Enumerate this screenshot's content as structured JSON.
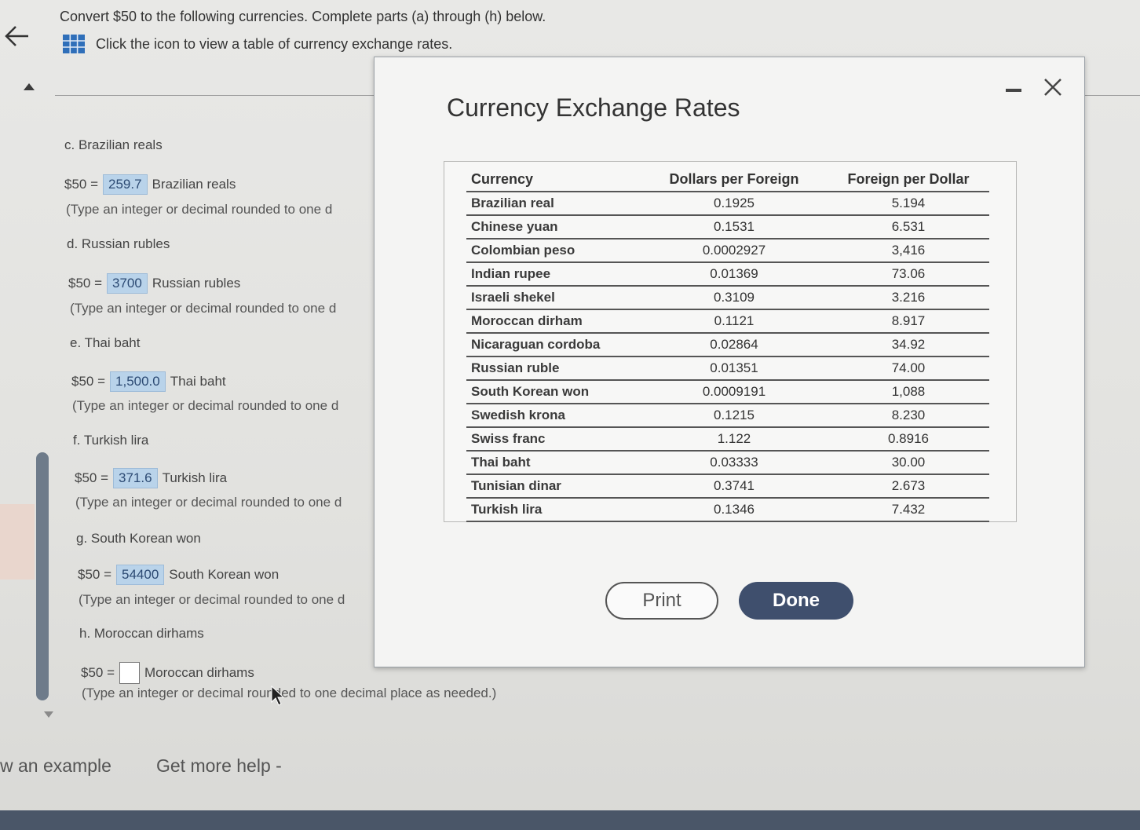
{
  "question": {
    "title": "Convert $50 to the following currencies. Complete parts (a) through (h) below.",
    "hint": "Click the icon to view a table of currency exchange rates."
  },
  "parts": [
    {
      "label": "c. Brazilian reals",
      "prefix": "$50 =",
      "value": "259.7",
      "unit": "Brazilian reals",
      "hint": "(Type an integer or decimal rounded to one d"
    },
    {
      "label": "d. Russian rubles",
      "prefix": "$50 =",
      "value": "3700",
      "unit": "Russian rubles",
      "hint": "(Type an integer or decimal rounded to one d"
    },
    {
      "label": "e. Thai baht",
      "prefix": "$50 =",
      "value": "1,500.0",
      "unit": "Thai baht",
      "hint": "(Type an integer or decimal rounded to one d"
    },
    {
      "label": "f. Turkish lira",
      "prefix": "$50 =",
      "value": "371.6",
      "unit": "Turkish lira",
      "hint": "(Type an integer or decimal rounded to one d"
    },
    {
      "label": "g. South Korean won",
      "prefix": "$50 =",
      "value": "54400",
      "unit": "South Korean won",
      "hint": "(Type an integer or decimal rounded to one d"
    },
    {
      "label": "h. Moroccan dirhams",
      "prefix": "$50 =",
      "value": "",
      "unit": "Moroccan dirhams",
      "hint": "(Type an integer or decimal rounded to one decimal place as needed.)"
    }
  ],
  "bottom": {
    "example": "w an example",
    "help": "Get more help -"
  },
  "dialog": {
    "title": "Currency Exchange Rates",
    "headers": [
      "Currency",
      "Dollars per Foreign",
      "Foreign per Dollar"
    ],
    "rows": [
      [
        "Brazilian real",
        "0.1925",
        "5.194"
      ],
      [
        "Chinese yuan",
        "0.1531",
        "6.531"
      ],
      [
        "Colombian peso",
        "0.0002927",
        "3,416"
      ],
      [
        "Indian rupee",
        "0.01369",
        "73.06"
      ],
      [
        "Israeli shekel",
        "0.3109",
        "3.216"
      ],
      [
        "Moroccan dirham",
        "0.1121",
        "8.917"
      ],
      [
        "Nicaraguan cordoba",
        "0.02864",
        "34.92"
      ],
      [
        "Russian ruble",
        "0.01351",
        "74.00"
      ],
      [
        "South Korean won",
        "0.0009191",
        "1,088"
      ],
      [
        "Swedish krona",
        "0.1215",
        "8.230"
      ],
      [
        "Swiss franc",
        "1.122",
        "0.8916"
      ],
      [
        "Thai baht",
        "0.03333",
        "30.00"
      ],
      [
        "Tunisian dinar",
        "0.3741",
        "2.673"
      ],
      [
        "Turkish lira",
        "0.1346",
        "7.432"
      ]
    ],
    "print_label": "Print",
    "done_label": "Done"
  },
  "colors": {
    "answer_bg": "#b9d3ea",
    "done_bg": "#3f4f6d",
    "scrollbar": "#6e7b8a"
  }
}
